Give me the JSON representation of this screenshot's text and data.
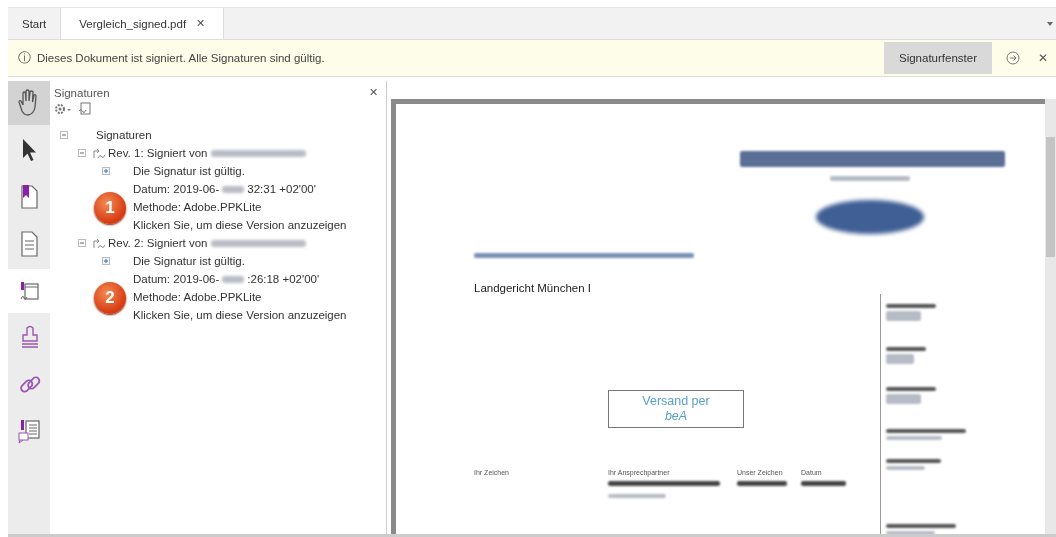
{
  "tabs": [
    {
      "label": "Start",
      "selected": false,
      "closable": false
    },
    {
      "label": "Vergleich_signed.pdf",
      "selected": true,
      "closable": true
    }
  ],
  "close_tab_glyph": "✕",
  "info_bar": {
    "icon": "ⓘ",
    "message": "Dieses Dokument ist signiert. Alle Signaturen sind gültig.",
    "button": "Signaturfenster",
    "close": "✕"
  },
  "tools": [
    {
      "kind": "hand",
      "selected": true
    },
    {
      "kind": "pointer",
      "selected": false
    },
    {
      "kind": "bookmarks",
      "selected": false
    },
    {
      "kind": "pages",
      "selected": false
    },
    {
      "kind": "signatures",
      "selected": true
    },
    {
      "kind": "stamp",
      "selected": false
    },
    {
      "kind": "link",
      "selected": false
    },
    {
      "kind": "comments",
      "selected": false
    }
  ],
  "panel": {
    "title": "Signaturen",
    "close": "✕",
    "tree": {
      "label": "Signaturen",
      "expanded": true,
      "children": [
        {
          "label": "Rev. 1: Signiert von",
          "expanded": true,
          "badge": "1",
          "children": [
            {
              "label": "Die Signatur ist gültig.",
              "expanded": false
            },
            {
              "label": "Datum: 2019-06-",
              "label_after": "32:31 +02'00'"
            },
            {
              "label": "Methode: Adobe.PPKLite"
            },
            {
              "label": "Klicken Sie, um diese Version anzuzeigen"
            }
          ]
        },
        {
          "label": "Rev. 2: Signiert von",
          "expanded": true,
          "badge": "2",
          "children": [
            {
              "label": "Die Signatur ist gültig.",
              "expanded": false
            },
            {
              "label": "Datum: 2019-06-",
              "label_after": ":26:18 +02'00'"
            },
            {
              "label": "Methode: Adobe.PPKLite"
            },
            {
              "label": "Klicken Sie, um diese Version anzuzeigen"
            }
          ]
        }
      ]
    }
  },
  "document": {
    "recipient": "Landgericht München I",
    "stamp_line_1": "Versand per",
    "stamp_line_2": "beA",
    "reference_labels": [
      "Ihr Zeichen",
      "Ihr Ansprechpartner",
      "Unser Zeichen",
      "Datum"
    ]
  }
}
